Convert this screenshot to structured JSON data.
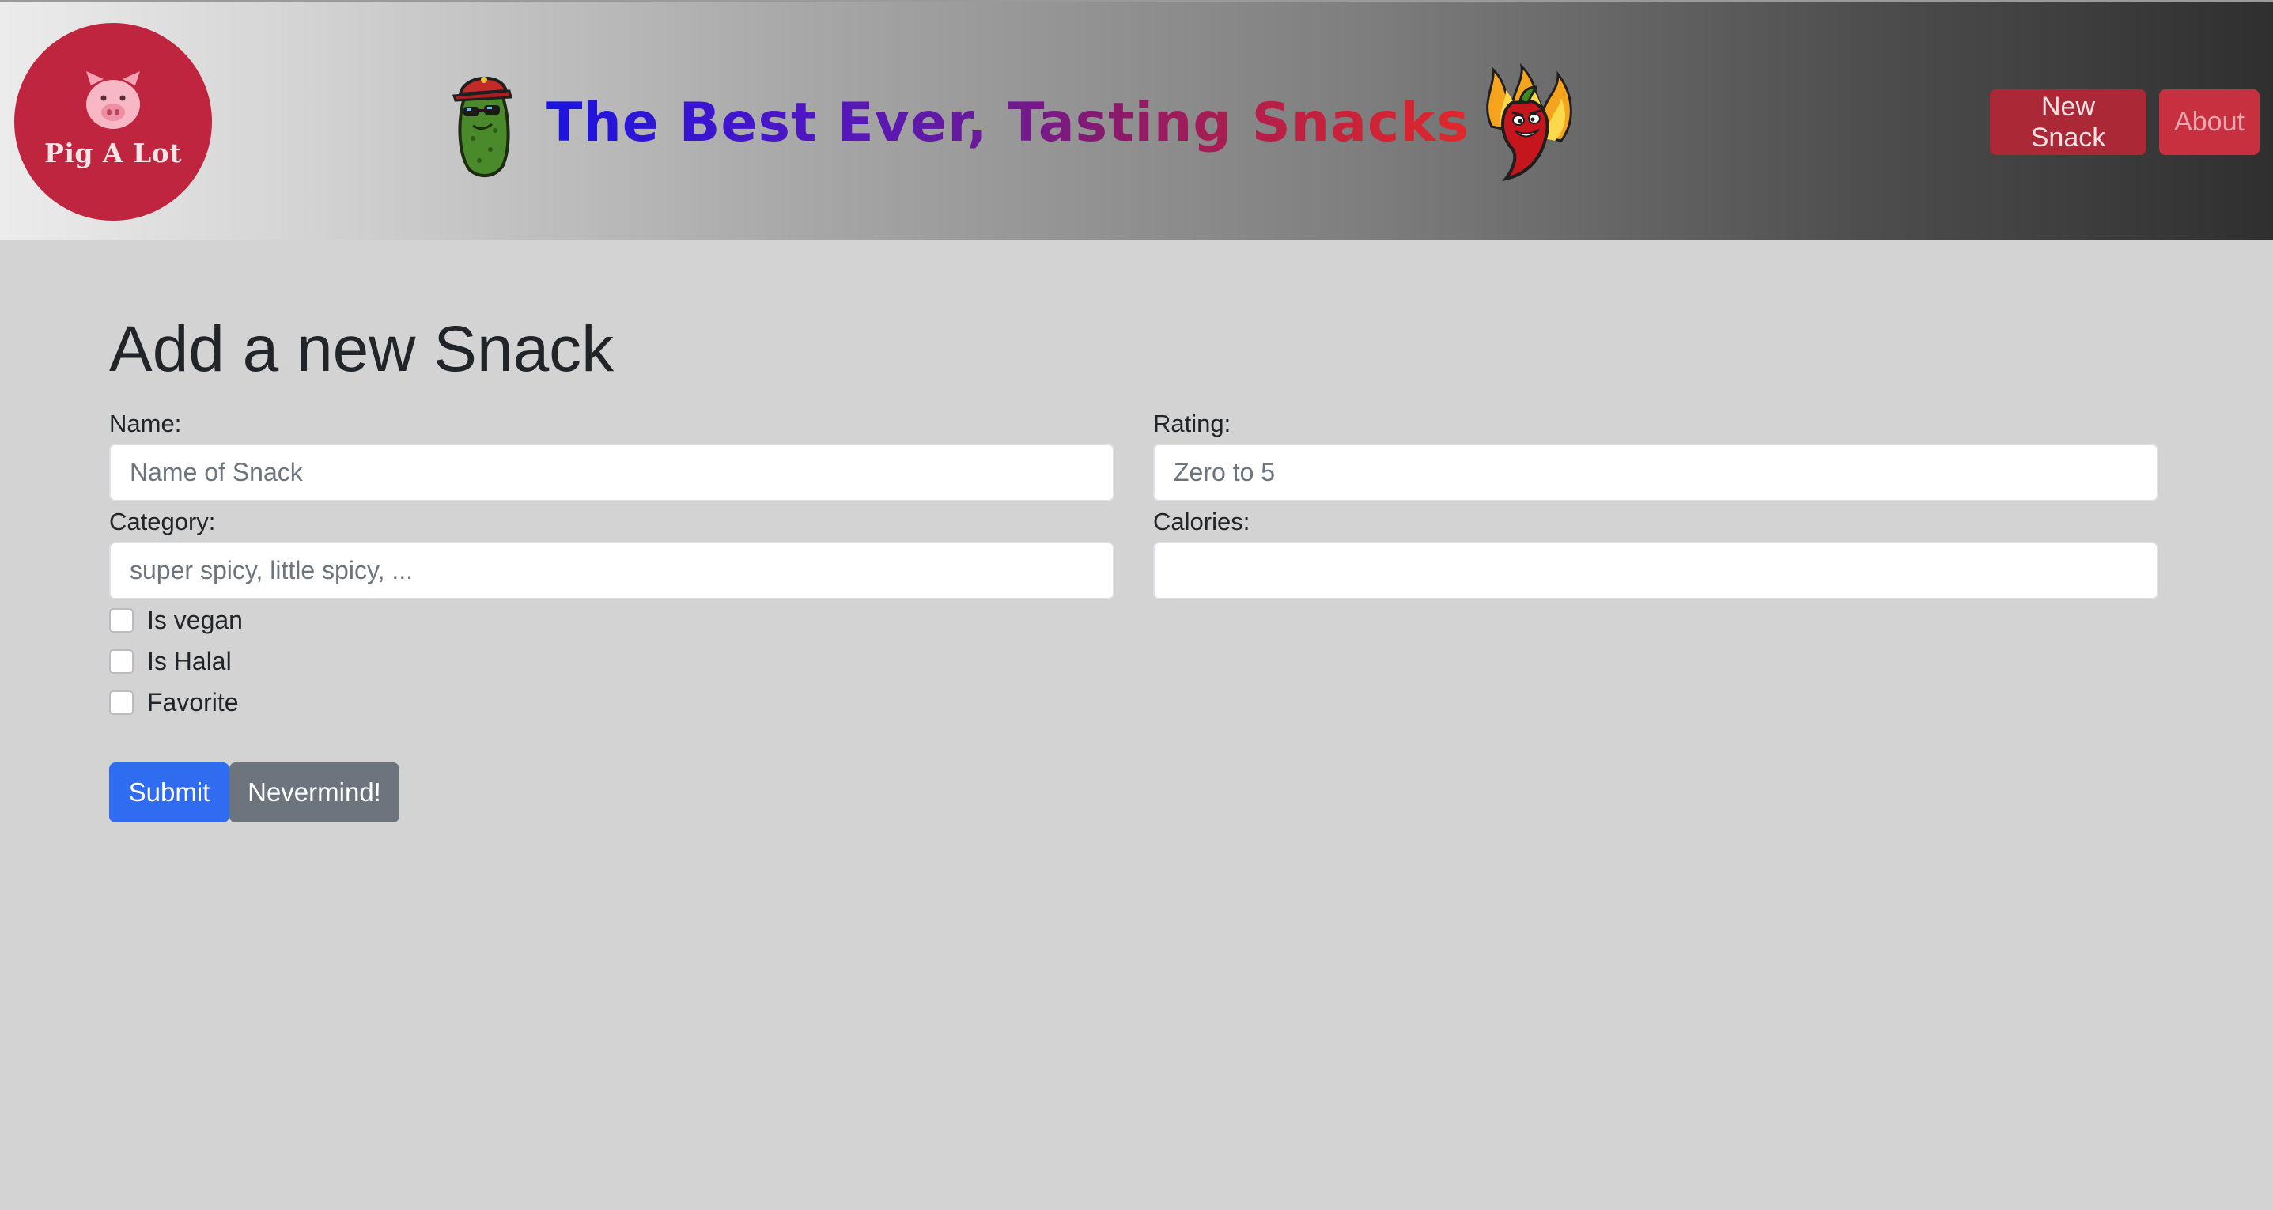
{
  "header": {
    "logo_text": "Pig A Lot",
    "title": "The Best Ever, Tasting Snacks",
    "nav": {
      "new_snack": "New Snack",
      "about": "About"
    }
  },
  "form": {
    "heading": "Add a new Snack",
    "name": {
      "label": "Name:",
      "placeholder": "Name of Snack",
      "value": ""
    },
    "rating": {
      "label": "Rating:",
      "placeholder": "Zero to 5",
      "value": ""
    },
    "category": {
      "label": "Category:",
      "placeholder": "super spicy, little spicy, ...",
      "value": ""
    },
    "calories": {
      "label": "Calories:",
      "placeholder": "",
      "value": ""
    },
    "checkboxes": {
      "vegan": {
        "label": "Is vegan",
        "checked": false
      },
      "halal": {
        "label": "Is Halal",
        "checked": false
      },
      "favorite": {
        "label": "Favorite",
        "checked": false
      }
    },
    "submit_label": "Submit",
    "cancel_label": "Nevermind!"
  },
  "colors": {
    "primary": "#2f6cf0",
    "secondary": "#6c757d",
    "danger": "#c8303f",
    "logo_bg": "#c0253f"
  },
  "icons": {
    "logo": "pig-icon",
    "brand_left": "pickle-mascot-icon",
    "brand_right": "chili-pepper-mascot-icon"
  }
}
